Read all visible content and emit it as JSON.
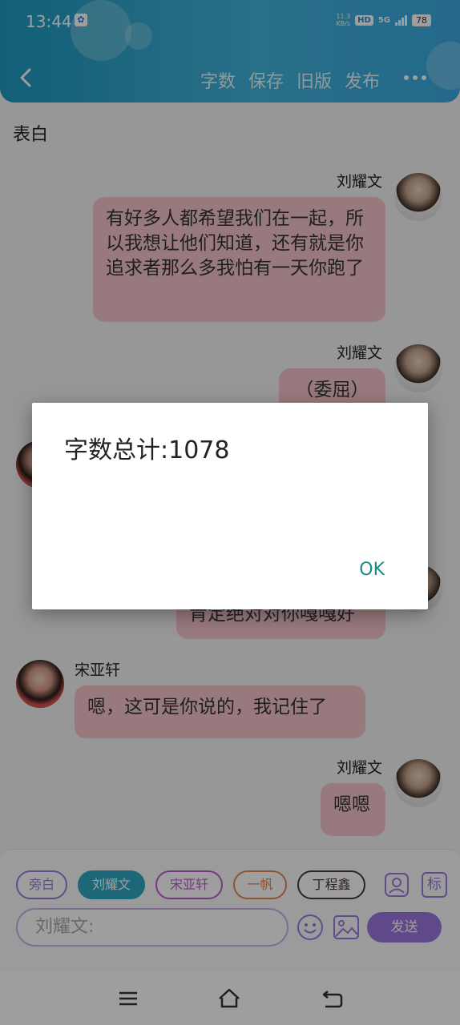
{
  "status": {
    "time": "13:44",
    "network_speed": "11.3",
    "network_unit": "KB/s",
    "hd": "HD",
    "signal": "5G",
    "battery": "78"
  },
  "nav": {
    "actions": [
      "字数",
      "保存",
      "旧版",
      "发布"
    ]
  },
  "doc_title": "表白",
  "messages": [
    {
      "sender": "刘耀文",
      "side": "right",
      "text": "有好多人都希望我们在一起，所以我想让他们知道，还有就是你追求者那么多我怕有一天你跑了"
    },
    {
      "sender": "刘耀文",
      "side": "right",
      "text": "（委屈）"
    },
    {
      "sender": "",
      "side": "right",
      "text": "肯定绝对对你嘎嘎好"
    },
    {
      "sender": "宋亚轩",
      "side": "left",
      "text": "嗯，这可是你说的，我记住了"
    },
    {
      "sender": "刘耀文",
      "side": "right",
      "text": "嗯嗯"
    }
  ],
  "input": {
    "roles": [
      "旁白",
      "刘耀文",
      "宋亚轩",
      "一帆",
      "丁程鑫"
    ],
    "active_role": "刘耀文",
    "role_colors": [
      "#9b7be0",
      "#2ea9c4",
      "#c25ad6",
      "#e7864f",
      "#4a3a36"
    ],
    "label_icon_text": "标",
    "placeholder": "刘耀文:",
    "send_label": "发送"
  },
  "dialog": {
    "message": "字数总计:1078",
    "ok_label": "OK"
  },
  "colors": {
    "header_accent": "#1e9ac0",
    "bubble": "#f6c6cc",
    "send": "#9b77e0",
    "dialog_button": "#1a8a86"
  }
}
